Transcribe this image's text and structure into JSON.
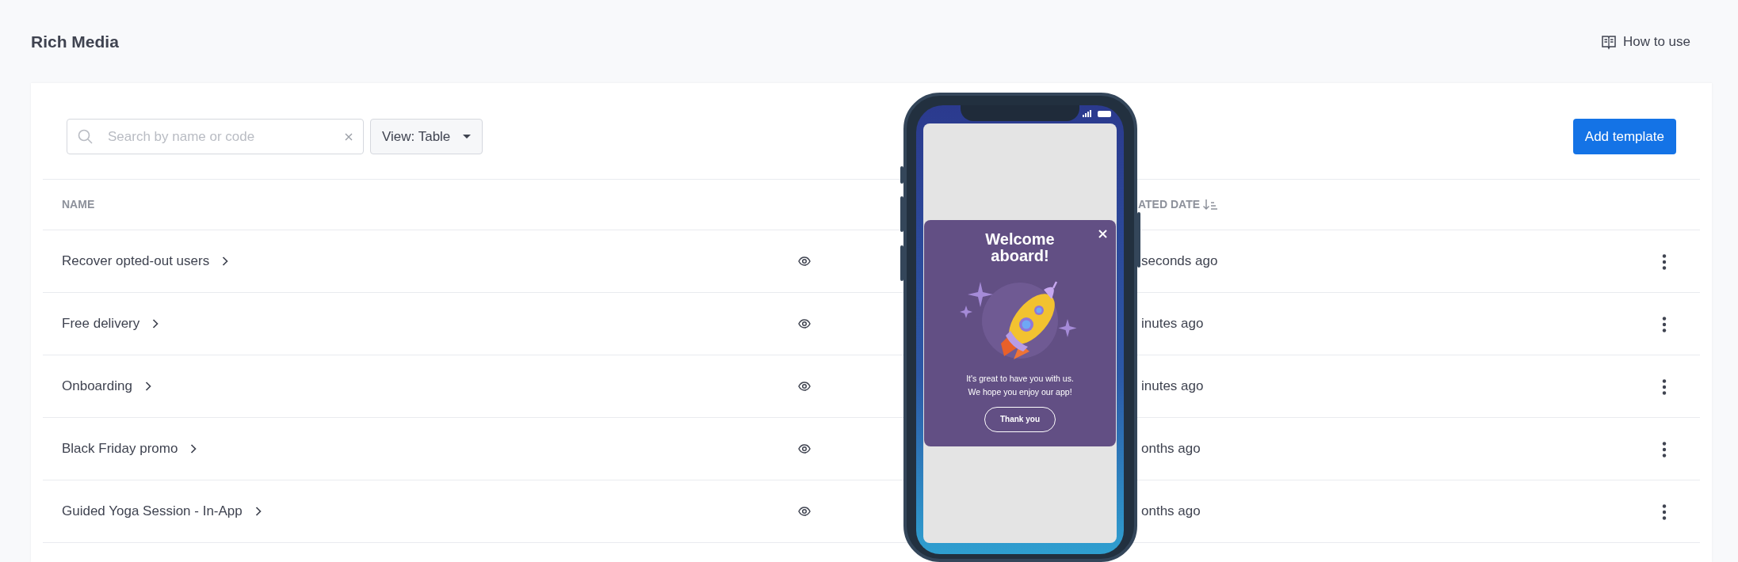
{
  "header": {
    "title": "Rich Media",
    "help_link": "How to use"
  },
  "toolbar": {
    "search": {
      "placeholder": "Search by name or code"
    },
    "view_dropdown": "View: Table",
    "add_button": "Add template"
  },
  "table": {
    "columns": [
      {
        "label": "NAME"
      },
      {
        "label": "ATED DATE",
        "sorted_descending": true
      }
    ],
    "rows": [
      {
        "name": "Recover opted-out users",
        "created": "seconds ago"
      },
      {
        "name": "Free delivery",
        "created": "inutes ago"
      },
      {
        "name": "Onboarding",
        "created": "inutes ago"
      },
      {
        "name": "Black Friday promo",
        "created": "onths ago"
      },
      {
        "name": "Guided Yoga Session - In-App",
        "created": "onths ago"
      }
    ]
  },
  "preview": {
    "popup_title": "Welcome aboard!",
    "message": "It's great to have you with us.\nWe hope you enjoy our app!",
    "button": "Thank you"
  }
}
